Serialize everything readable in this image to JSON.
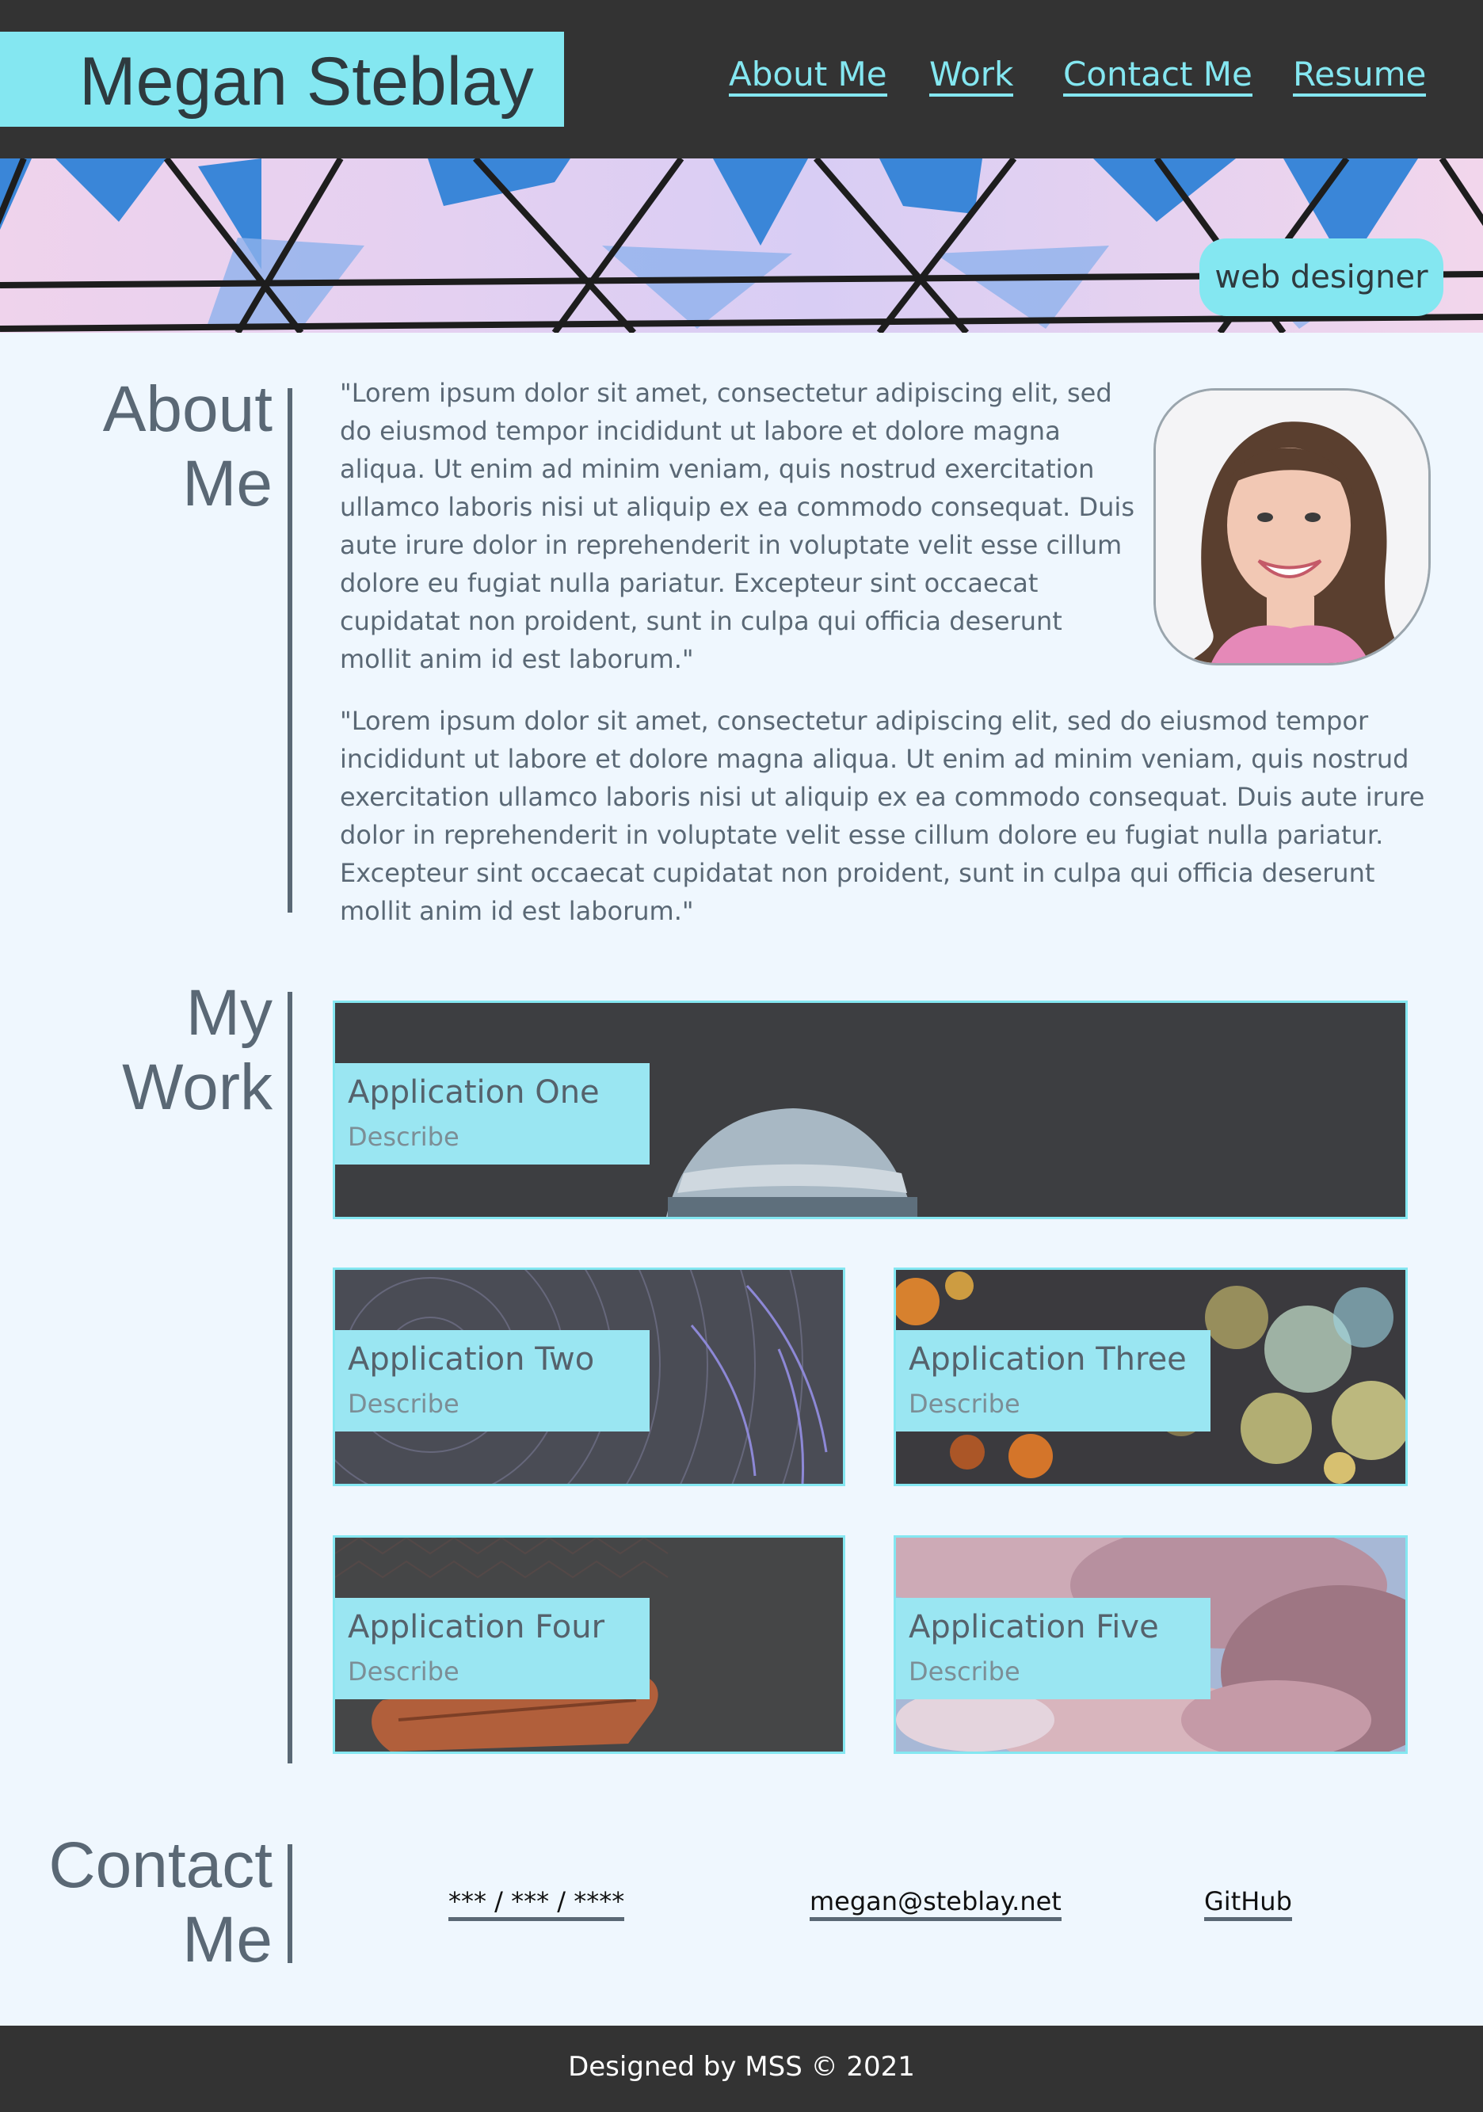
{
  "header": {
    "brand": "Megan Steblay",
    "nav": [
      "About Me",
      "Work",
      "Contact Me",
      "Resume"
    ]
  },
  "banner": {
    "role": "web designer"
  },
  "about": {
    "title_line1": "About",
    "title_line2": "Me",
    "para1_lines": [
      "\"Lorem ipsum dolor sit amet, consectetur adipiscing elit, sed",
      "do eiusmod tempor incididunt ut labore et dolore magna",
      "aliqua. Ut enim ad minim veniam, quis nostrud exercitation",
      "ullamco laboris nisi ut aliquip ex ea commodo consequat. Duis",
      "aute irure dolor in reprehenderit in voluptate velit esse cillum",
      "dolore eu fugiat nulla pariatur. Excepteur sint occaecat",
      "cupidatat non proident, sunt in culpa qui officia deserunt",
      "mollit anim id est laborum.\""
    ],
    "para2_lines": [
      "\"Lorem ipsum dolor sit amet, consectetur adipiscing elit, sed do eiusmod tempor",
      "incididunt ut labore et dolore magna aliqua. Ut enim ad minim veniam, quis nostrud",
      "exercitation ullamco laboris nisi ut aliquip ex ea commodo consequat. Duis aute irure",
      "dolor in reprehenderit in voluptate velit esse cillum dolore eu fugiat nulla pariatur.",
      "Excepteur sint occaecat cupidatat non proident, sunt in culpa qui officia deserunt",
      "mollit anim id est laborum.\""
    ]
  },
  "work": {
    "title_line1": "My",
    "title_line2": "Work",
    "apps": [
      {
        "title": "Application One",
        "desc": "Describe"
      },
      {
        "title": "Application Two",
        "desc": "Describe"
      },
      {
        "title": "Application Three",
        "desc": "Describe"
      },
      {
        "title": "Application Four",
        "desc": "Describe"
      },
      {
        "title": "Application Five",
        "desc": "Describe"
      }
    ]
  },
  "contact": {
    "title_line1": "Contact",
    "title_line2": "Me",
    "phone": "*** / *** / ****",
    "email": "megan@steblay.net",
    "github": "GitHub"
  },
  "footer": {
    "text": "Designed by MSS © 2021"
  },
  "colors": {
    "accent": "#84e7f1",
    "dark": "#333333",
    "text": "#5a6875",
    "background": "#eff7fe"
  }
}
